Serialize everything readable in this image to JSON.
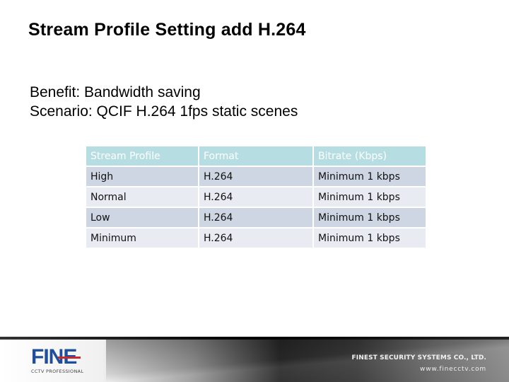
{
  "slide": {
    "title": "Stream Profile Setting add H.264",
    "body_lines": [
      "Benefit: Bandwidth saving",
      "Scenario: QCIF  H.264 1fps static scenes"
    ]
  },
  "table": {
    "headers": [
      "Stream Profile",
      "Format",
      "Bitrate (Kbps)"
    ],
    "rows": [
      [
        "High",
        "H.264",
        "Minimum 1 kbps"
      ],
      [
        "Normal",
        "H.264",
        "Minimum 1 kbps"
      ],
      [
        "Low",
        "H.264",
        "Minimum 1 kbps"
      ],
      [
        "Minimum",
        "H.264",
        "Minimum 1 kbps"
      ]
    ],
    "colors": {
      "header_bg": "#b6dde1",
      "odd_row_bg": "#cfd6e3",
      "even_row_bg": "#e8ebf1"
    }
  },
  "footer": {
    "logo_text": "FINE",
    "logo_subtitle": "CCTV PROFESSIONAL",
    "company_name": "FINEST SECURITY SYSTEMS CO., LTD.",
    "website": "www.finecctv.com",
    "logo_color": "#1f4e9a",
    "logo_accent": "#c8282e"
  }
}
